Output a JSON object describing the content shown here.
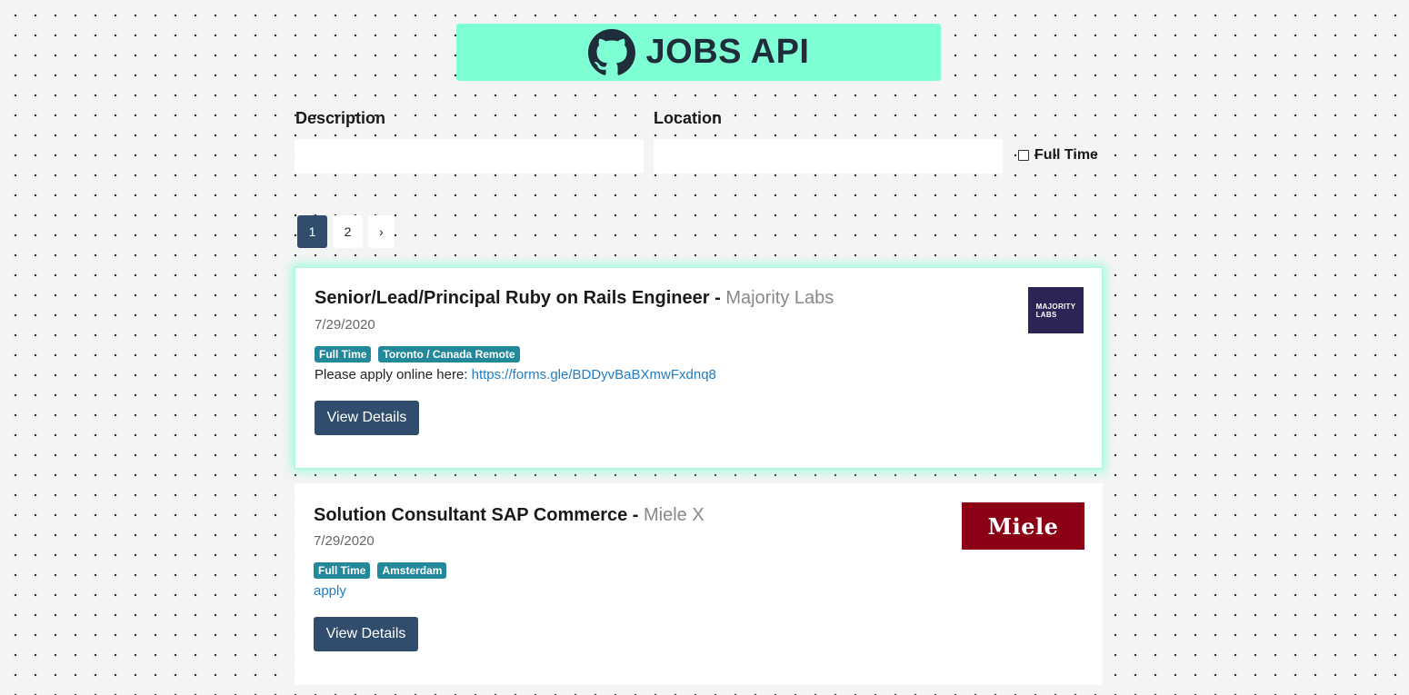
{
  "header": {
    "title": "JOBS API",
    "icon": "github-icon",
    "background": "#7fffd4"
  },
  "filters": {
    "description_label": "Description",
    "description_value": "",
    "location_label": "Location",
    "location_value": "",
    "full_time_label": "Full Time",
    "full_time_checked": false
  },
  "pagination": {
    "pages": [
      "1",
      "2"
    ],
    "active_page": "1",
    "next_label": "›"
  },
  "jobs": [
    {
      "title": "Senior/Lead/Principal Ruby on Rails Engineer",
      "separator": " - ",
      "company": "Majority Labs",
      "date": "7/29/2020",
      "tags": [
        "Full Time",
        "Toronto / Canada Remote"
      ],
      "desc_prefix": "Please apply online here: ",
      "link_text": "https://forms.gle/BDDyvBaBXmwFxdnq8",
      "button_label": "View Details",
      "logo_text": "MAJORITY LABS",
      "logo_color": "#2b2455"
    },
    {
      "title": "Solution Consultant SAP Commerce",
      "separator": " - ",
      "company": "Miele X",
      "date": "7/29/2020",
      "tags": [
        "Full Time",
        "Amsterdam"
      ],
      "desc_prefix": "",
      "link_text": "apply",
      "button_label": "View Details",
      "logo_text": "Miele",
      "logo_color": "#8b0015"
    }
  ],
  "colors": {
    "primary": "#304d6d",
    "tag": "#23899a",
    "link": "#1f7dc5",
    "accent": "#7fffd4"
  }
}
